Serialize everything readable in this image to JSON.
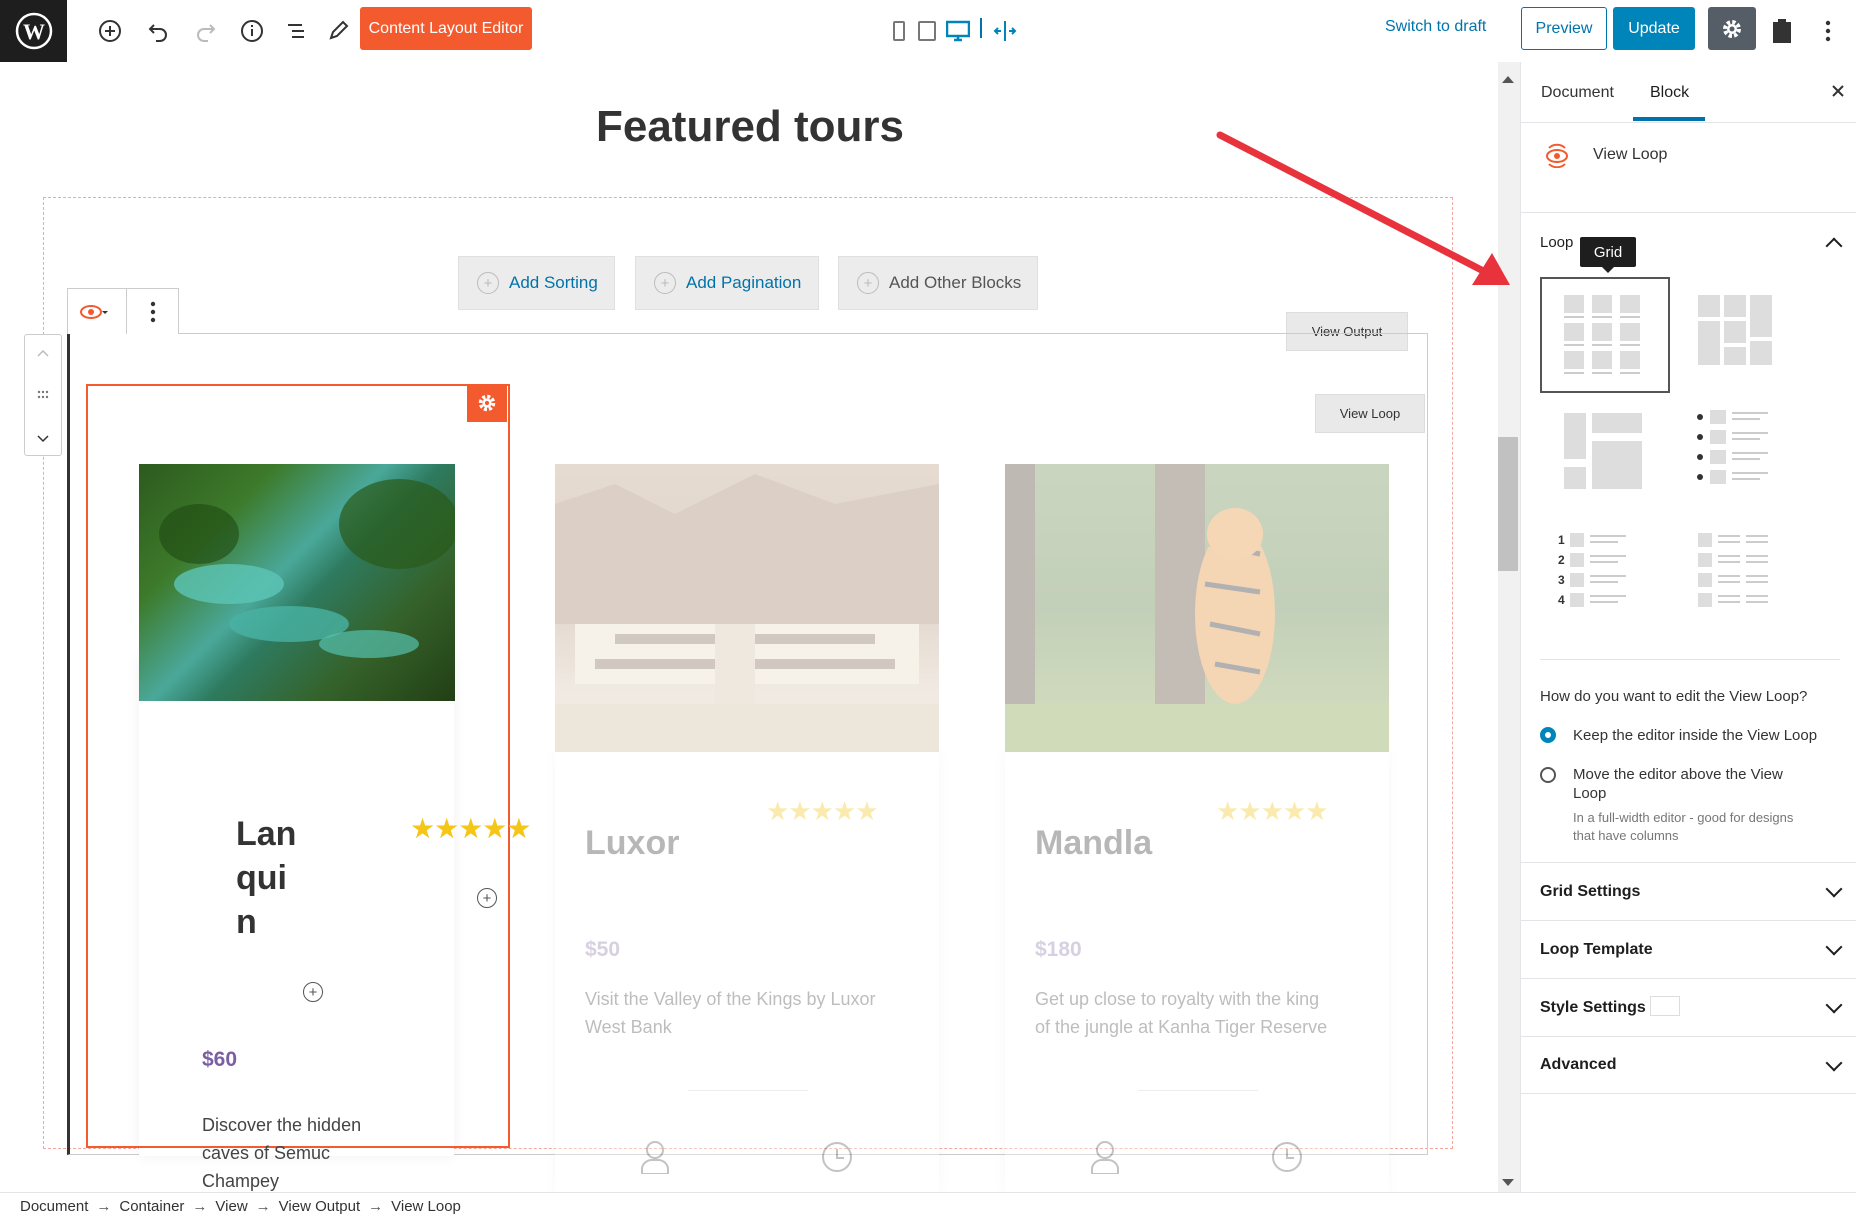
{
  "toolbar": {
    "content_layout_editor": "Content Layout Editor",
    "switch_to_draft": "Switch to draft",
    "preview": "Preview",
    "update": "Update"
  },
  "canvas": {
    "page_title": "Featured tours",
    "add_sorting": "Add Sorting",
    "add_pagination": "Add Pagination",
    "add_other_blocks": "Add Other Blocks",
    "view_output_label": "View Output",
    "view_loop_label": "View Loop"
  },
  "tours": [
    {
      "title_lines": [
        "Lan",
        "qui",
        "n"
      ],
      "price": "$60",
      "description_lines": [
        "Discover the hidden",
        "caves of Semuc",
        "Champey"
      ],
      "stars": "★★★★★"
    },
    {
      "title": "Luxor",
      "price": "$50",
      "description_lines": [
        "Visit the Valley of the Kings by Luxor",
        "West Bank"
      ],
      "stars": "★★★★★"
    },
    {
      "title": "Mandla",
      "price": "$180",
      "description_lines": [
        "Get up close to royalty with the king",
        "of the jungle at Kanha Tiger Reserve"
      ],
      "stars": "★★★★★"
    }
  ],
  "sidebar": {
    "tab_document": "Document",
    "tab_block": "Block",
    "block_name": "View Loop",
    "loop_section": "Loop",
    "tooltip": "Grid",
    "edit_question": "How do you want to edit the View Loop?",
    "option_keep": "Keep the editor inside the View Loop",
    "option_move_line1": "Move the editor above the View",
    "option_move_line2": "Loop",
    "option_move_hint_line1": "In a full-width editor - good for designs",
    "option_move_hint_line2": "that have columns",
    "grid_settings": "Grid Settings",
    "loop_template": "Loop Template",
    "style_settings": "Style Settings",
    "advanced": "Advanced",
    "list_numbers": [
      "1",
      "2",
      "3",
      "4"
    ]
  },
  "breadcrumb": [
    "Document",
    "Container",
    "View",
    "View Output",
    "View Loop"
  ],
  "colors": {
    "accent": "#f35a2d",
    "primary": "#0085ba",
    "link": "#0073aa",
    "arrow": "#e8323c"
  }
}
